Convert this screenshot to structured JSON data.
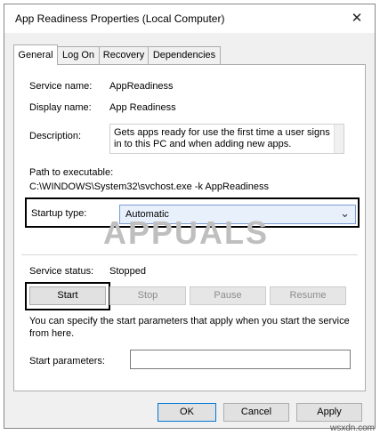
{
  "window": {
    "title": "App Readiness Properties (Local Computer)"
  },
  "tabs": [
    {
      "label": "General"
    },
    {
      "label": "Log On"
    },
    {
      "label": "Recovery"
    },
    {
      "label": "Dependencies"
    }
  ],
  "general": {
    "service_name_label": "Service name:",
    "service_name": "AppReadiness",
    "display_name_label": "Display name:",
    "display_name": "App Readiness",
    "description_label": "Description:",
    "description": "Gets apps ready for use the first time a user signs in to this PC and when adding new apps.",
    "path_label": "Path to executable:",
    "path": "C:\\WINDOWS\\System32\\svchost.exe -k AppReadiness",
    "startup_type_label": "Startup type:",
    "startup_type": "Automatic",
    "status_label": "Service status:",
    "status": "Stopped",
    "buttons": {
      "start": "Start",
      "stop": "Stop",
      "pause": "Pause",
      "resume": "Resume"
    },
    "start_params_text": "You can specify the start parameters that apply when you start the service from here.",
    "start_params_label": "Start parameters:",
    "start_params_value": ""
  },
  "watermark": "APPUALS",
  "footer": {
    "ok": "OK",
    "cancel": "Cancel",
    "apply": "Apply"
  },
  "site": "wsxdn.com"
}
